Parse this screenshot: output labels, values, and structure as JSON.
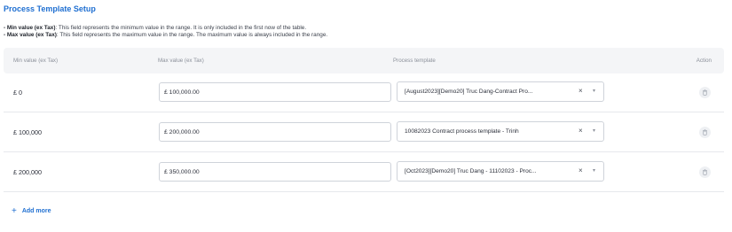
{
  "title": "Process Template Setup",
  "notes": {
    "min_label": "- Min value (ex Tax)",
    "min_text": ": This field represents the minimum value in the range. It is only included in the first now of the table.",
    "max_label": "- Max value (ex Tax)",
    "max_text": ": This field represents the maximum value in the range. The maximum value is always included in the range."
  },
  "table": {
    "headers": {
      "min": "Min value (ex Tax)",
      "max": "Max value (ex Tax)",
      "process": "Process template",
      "action": "Action"
    },
    "rows": [
      {
        "min": "£  0",
        "max": "£ 100,000.00",
        "process": "[August2023][Demo20] Truc Dang-Contract Pro..."
      },
      {
        "min": "£  100,000",
        "max": "£ 200,000.00",
        "process": "10082023 Contract process template - Trinh"
      },
      {
        "min": "£  200,000",
        "max": "£ 350,000.00",
        "process": "[Oct2023][Demo20] Truc Dang - 11102023 - Proc..."
      }
    ],
    "clear_glyph": "×",
    "chevron_glyph": "▾"
  },
  "add_more": {
    "icon": "+",
    "label": "Add more"
  },
  "colors": {
    "accent": "#1f6fd1",
    "header_bg": "#f4f5f7",
    "border": "#cfd3da"
  }
}
